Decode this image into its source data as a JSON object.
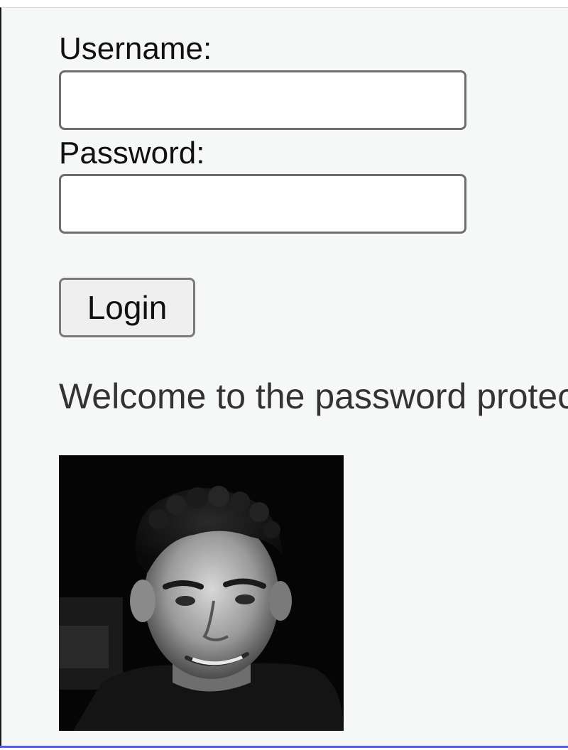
{
  "login_form": {
    "username_label": "Username:",
    "username_value": "",
    "password_label": "Password:",
    "password_value": "",
    "login_label": "Login"
  },
  "content": {
    "welcome_text": "Welcome to the password protected",
    "photo_icon": "portrait-photo"
  },
  "colors": {
    "background": "#f6f8f8",
    "text": "#333333",
    "accent_rule": "#5b5fd6"
  }
}
